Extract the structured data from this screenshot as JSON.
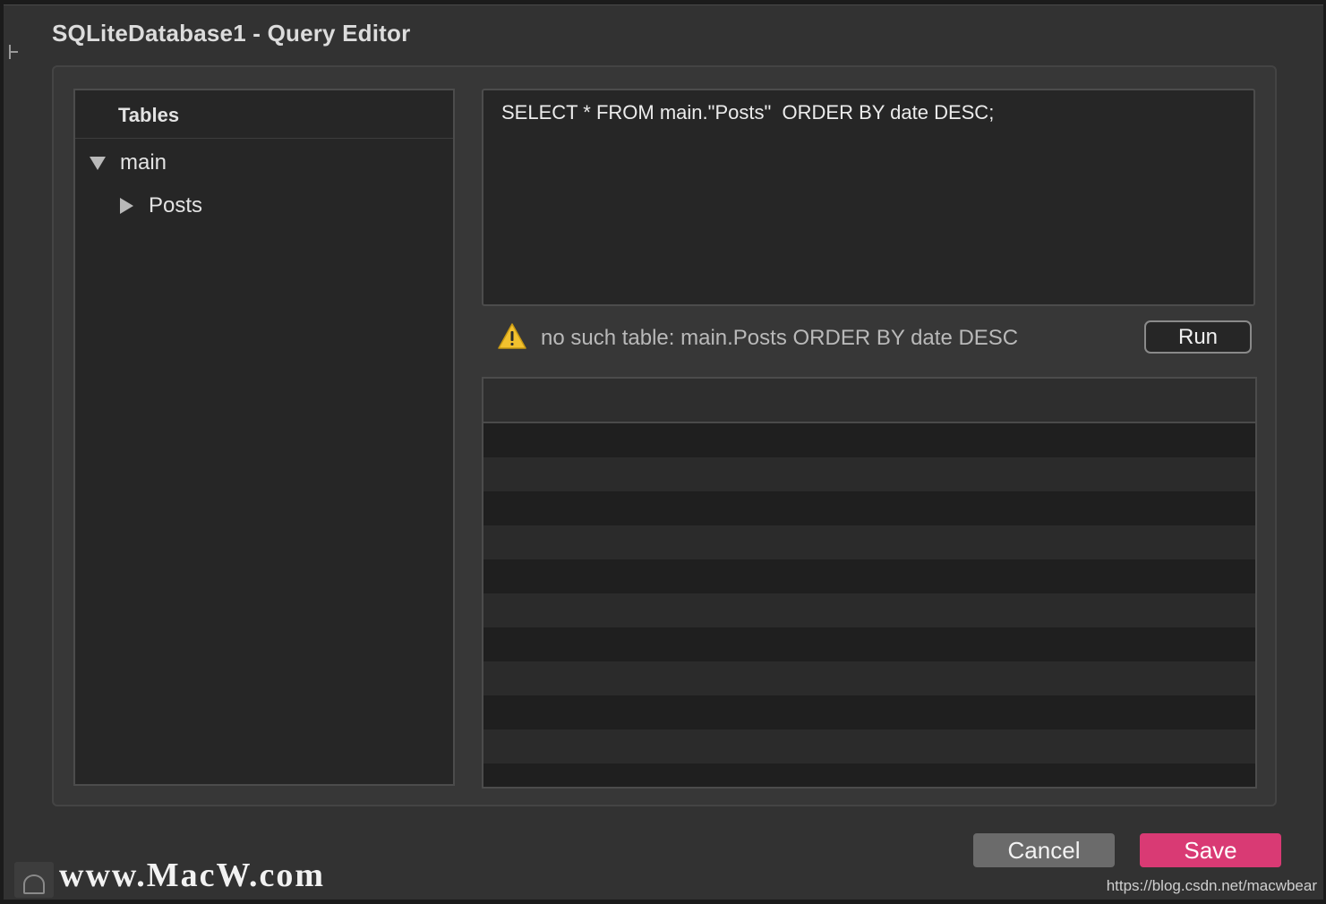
{
  "dialog": {
    "title": "SQLiteDatabase1 - Query Editor"
  },
  "tables": {
    "header": "Tables",
    "tree": [
      {
        "label": "main",
        "expanded": true,
        "children": [
          {
            "label": "Posts",
            "expanded": false
          }
        ]
      }
    ]
  },
  "query": {
    "text": "SELECT * FROM main.\"Posts\"  ORDER BY date DESC;"
  },
  "status": {
    "icon": "warning-icon",
    "message": "no such table: main.Posts ORDER BY date DESC",
    "run_label": "Run"
  },
  "results": {
    "columns": [],
    "rows": []
  },
  "buttons": {
    "cancel_label": "Cancel",
    "save_label": "Save"
  },
  "watermarks": {
    "macw": "www.MacW.com",
    "csdn": "https://blog.csdn.net/macwbear"
  },
  "colors": {
    "accent": "#d93a74",
    "warning": "#f2c12e",
    "background": "#323232"
  }
}
